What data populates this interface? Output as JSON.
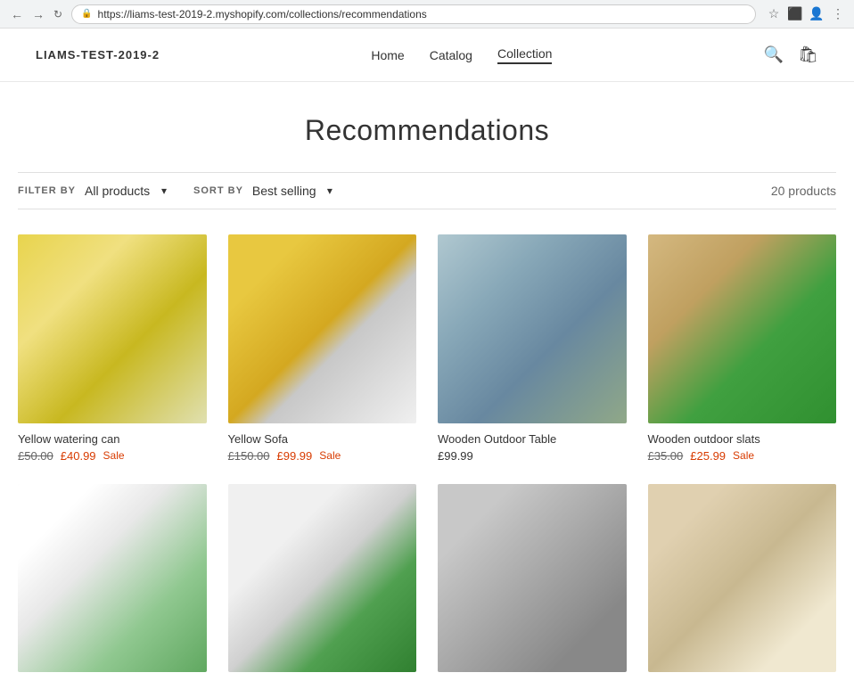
{
  "browser": {
    "url": "https://liams-test-2019-2.myshopify.com/collections/recommendations",
    "back_arrow": "←",
    "forward_arrow": "→",
    "reload": "↻"
  },
  "site": {
    "logo": "LIAMS-TEST-2019-2",
    "nav": [
      {
        "label": "Home",
        "active": false
      },
      {
        "label": "Catalog",
        "active": false
      },
      {
        "label": "Collection",
        "active": true
      }
    ]
  },
  "page": {
    "title": "Recommendations"
  },
  "filter": {
    "filter_by_label": "FILTER BY",
    "filter_value": "All products",
    "sort_by_label": "SORT BY",
    "sort_value": "Best selling",
    "products_count": "20 products"
  },
  "products": [
    {
      "id": "yellow-watering-can",
      "name": "Yellow watering can",
      "original_price": "£50.00",
      "sale_price": "£40.99",
      "on_sale": true,
      "image_class": "img-yellow-watering-can"
    },
    {
      "id": "yellow-sofa",
      "name": "Yellow Sofa",
      "original_price": "£150.00",
      "sale_price": "£99.99",
      "on_sale": true,
      "image_class": "img-yellow-sofa"
    },
    {
      "id": "wooden-outdoor-table",
      "name": "Wooden Outdoor Table",
      "original_price": null,
      "sale_price": null,
      "regular_price": "£99.99",
      "on_sale": false,
      "image_class": "img-wooden-outdoor-table"
    },
    {
      "id": "wooden-outdoor-slats",
      "name": "Wooden outdoor slats",
      "original_price": "£35.00",
      "sale_price": "£25.99",
      "on_sale": true,
      "image_class": "img-wooden-outdoor-slats"
    },
    {
      "id": "house-fence",
      "name": "",
      "original_price": null,
      "sale_price": null,
      "regular_price": "",
      "on_sale": false,
      "image_class": "img-house-fence"
    },
    {
      "id": "plant-pot",
      "name": "",
      "original_price": null,
      "sale_price": null,
      "regular_price": "",
      "on_sale": false,
      "image_class": "img-plant-pot"
    },
    {
      "id": "bedroom",
      "name": "",
      "original_price": null,
      "sale_price": null,
      "regular_price": "",
      "on_sale": false,
      "image_class": "img-bedroom"
    },
    {
      "id": "living-room",
      "name": "",
      "original_price": null,
      "sale_price": null,
      "regular_price": "",
      "on_sale": false,
      "image_class": "img-living-room"
    }
  ],
  "labels": {
    "sale": "Sale"
  }
}
